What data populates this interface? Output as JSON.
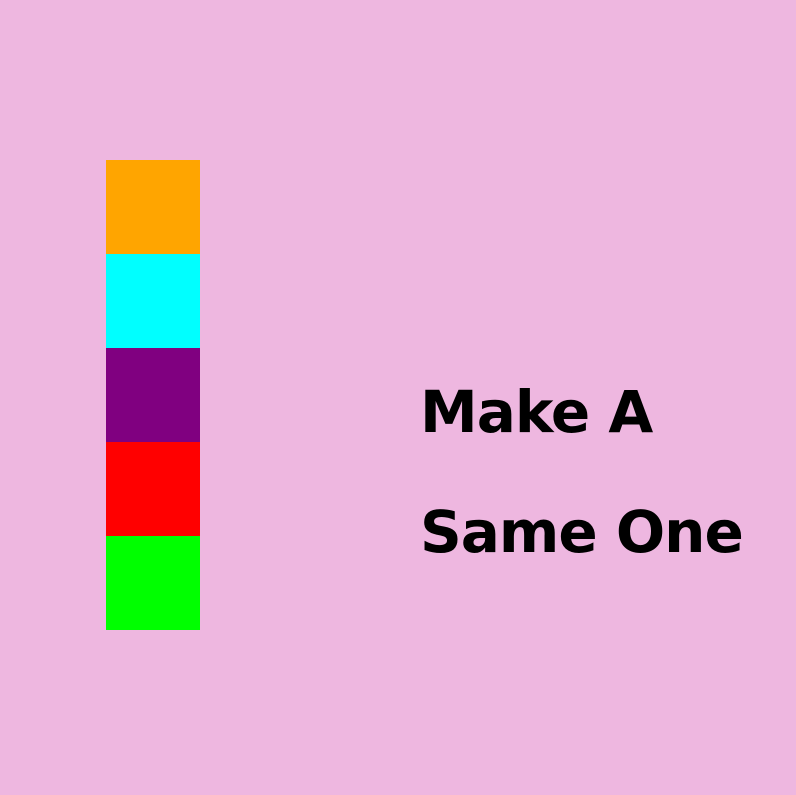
{
  "background_color": "#EEB7E0",
  "blocks": [
    {
      "name": "orange",
      "color": "#FFA500"
    },
    {
      "name": "cyan",
      "color": "#00FFFF"
    },
    {
      "name": "purple",
      "color": "#800080"
    },
    {
      "name": "red",
      "color": "#FF0000"
    },
    {
      "name": "green",
      "color": "#00FF00"
    }
  ],
  "instruction": {
    "line1": "Make A",
    "line2": "Same One"
  }
}
